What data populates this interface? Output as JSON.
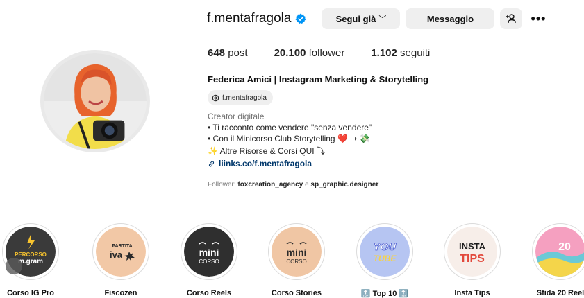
{
  "profile": {
    "username": "f.mentafragola",
    "follow_label": "Segui già",
    "message_label": "Messaggio",
    "posts_count": "648",
    "posts_label": "post",
    "followers_count": "20.100",
    "followers_label": "follower",
    "following_count": "1.102",
    "following_label": "seguiti",
    "full_name": "Federica Amici | Instagram Marketing & Storytelling",
    "threads_handle": "f.mentafragola",
    "category": "Creator digitale",
    "bio": [
      "• Ti racconto come vendere \"senza vendere\"",
      "• Con il Minicorso Club Storytelling ❤️ ➝ 💸",
      "✨ Altre Risorse & Corsi QUI ⤵"
    ],
    "link": "liinks.co/f.mentafragola",
    "followed_by_prefix": "Follower:",
    "followed_by_user1": "foxcreation_agency",
    "followed_by_conj": "e",
    "followed_by_user2": "sp_graphic.designer"
  },
  "highlights": [
    {
      "label": "Corso IG Pro",
      "cover_text": [
        "PERCORSO",
        "m.gram"
      ],
      "bg": "#3a3a3a"
    },
    {
      "label": "Fiscozen",
      "cover_text": [
        "PARTITA",
        "iva"
      ],
      "bg": "#f2c8a6"
    },
    {
      "label": "Corso Reels",
      "cover_text": [
        "mini",
        "CORSO"
      ],
      "bg": "#2f2f2f"
    },
    {
      "label": "Corso Stories",
      "cover_text": [
        "mini",
        "CORSO"
      ],
      "bg": "#f0c6a4"
    },
    {
      "label": "🔝 Top 10 🔝",
      "cover_text": [
        "YOU",
        "TUBE"
      ],
      "bg": "#b6c5f2"
    },
    {
      "label": "Insta Tips",
      "cover_text": [
        "INSTA",
        "TIPS"
      ],
      "bg": "#f7eee9"
    },
    {
      "label": "Sfida 20 Reel",
      "cover_text": [
        "20"
      ],
      "bg": "#f5a0c0"
    }
  ],
  "icons": {
    "verified": "verified-badge-icon",
    "more": "more-options-icon",
    "add_user": "suggested-users-icon",
    "threads": "threads-icon",
    "link": "link-icon"
  },
  "colors": {
    "verified": "#0095f6",
    "link": "#00376b",
    "button_bg": "#efefef"
  }
}
